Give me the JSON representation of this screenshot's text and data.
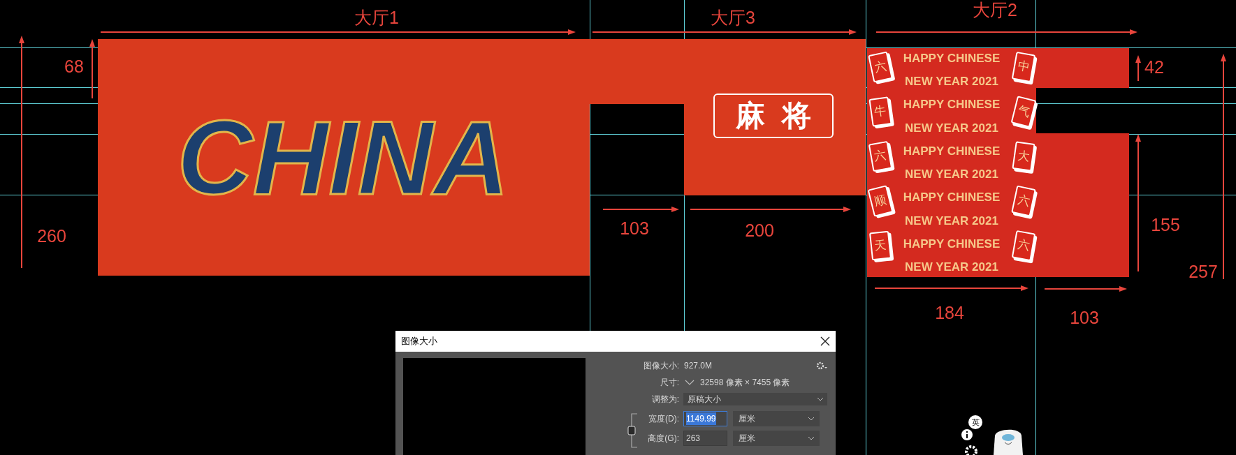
{
  "annotations": [
    {
      "kind": "horizontal",
      "text": "大厅1"
    },
    {
      "kind": "horizontal",
      "text": "大厅3"
    },
    {
      "kind": "horizontal",
      "text": "大厅2"
    },
    {
      "kind": "vertical",
      "text": "68"
    },
    {
      "kind": "vertical",
      "text": "42"
    },
    {
      "kind": "vertical",
      "text": "260"
    },
    {
      "kind": "horizontal",
      "text": "103"
    },
    {
      "kind": "horizontal",
      "text": "200"
    },
    {
      "kind": "vertical",
      "text": "155"
    },
    {
      "kind": "vertical",
      "text": "257"
    },
    {
      "kind": "horizontal",
      "text": "184"
    },
    {
      "kind": "horizontal",
      "text": "103"
    }
  ],
  "banner_1": {
    "lettering": "CHINA"
  },
  "banner_3": {
    "logo_text": "麻将"
  },
  "banner_2": {
    "poster_lines": [
      "HAPPY CHINESE",
      "NEW YEAR 2021",
      "HAPPY CHINESE",
      "NEW YEAR 2021",
      "HAPPY CHINESE",
      "NEW YEAR 2021",
      "HAPPY CHINESE",
      "NEW YEAR 2021",
      "HAPPY CHINESE",
      "NEW YEAR 2021"
    ],
    "tiles": [
      "六",
      "中",
      "牛",
      "气",
      "六",
      "大",
      "顺",
      "六",
      "天",
      "六"
    ]
  },
  "dialog": {
    "title": "图像大小",
    "rows": [
      {
        "kind": "info",
        "label": "图像大小:",
        "value": "927.0M"
      },
      {
        "kind": "dims",
        "label": "尺寸:",
        "value": "32598 像素 × 7455 像素"
      },
      {
        "kind": "select",
        "label": "调整为:",
        "value": "原稿大小"
      },
      {
        "kind": "input",
        "label": "宽度(D):",
        "value": "1149.99",
        "selected": true,
        "unit": "厘米"
      },
      {
        "kind": "input",
        "label": "高度(G):",
        "value": "263",
        "selected": false,
        "unit": "厘米"
      }
    ]
  },
  "overlay": {
    "input_method": "英"
  }
}
